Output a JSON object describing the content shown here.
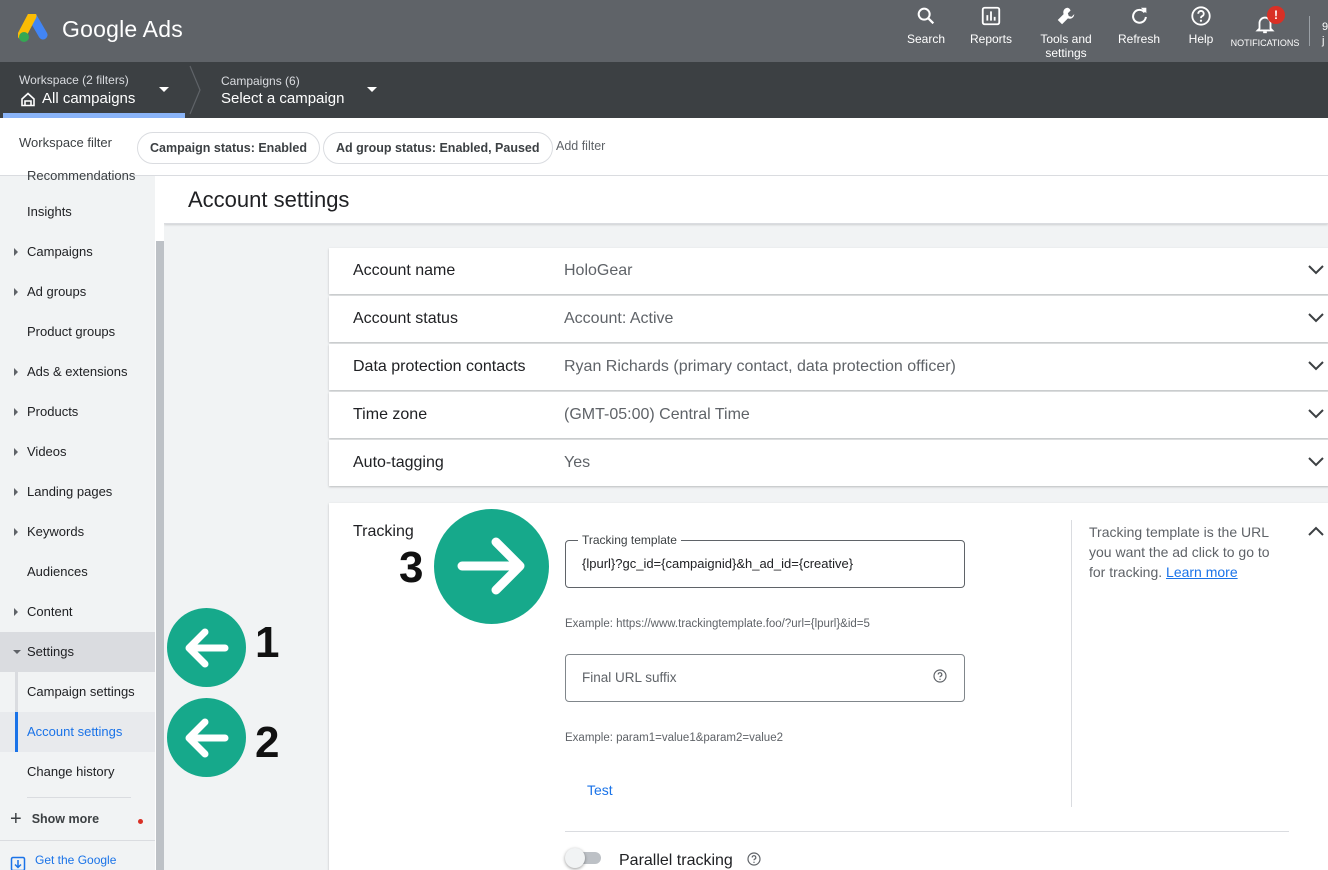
{
  "app": {
    "title": "Google Ads"
  },
  "top_nav": [
    {
      "label": "Search",
      "icon": "search-icon"
    },
    {
      "label": "Reports",
      "icon": "reports-icon"
    },
    {
      "label": "Tools and",
      "label2": "settings",
      "icon": "wrench-icon"
    },
    {
      "label": "Refresh",
      "icon": "refresh-icon"
    },
    {
      "label": "Help",
      "icon": "help-icon"
    },
    {
      "label": "NOTIFICATIONS",
      "icon": "bell-icon",
      "badge": "!"
    }
  ],
  "account_peek": {
    "line1": "9",
    "line2": "j"
  },
  "workspace": {
    "label": "Workspace (2 filters)",
    "value": "All campaigns"
  },
  "campaigns": {
    "label": "Campaigns (6)",
    "value": "Select a campaign"
  },
  "filter_bar": {
    "label": "Workspace filter",
    "chips": [
      "Campaign status: Enabled",
      "Ad group status: Enabled, Paused"
    ],
    "add_filter": "Add filter"
  },
  "sidebar": {
    "cut_item": "Recommendations",
    "items": [
      {
        "label": "Insights",
        "expandable": false
      },
      {
        "label": "Campaigns",
        "expandable": true
      },
      {
        "label": "Ad groups",
        "expandable": true
      },
      {
        "label": "Product groups",
        "expandable": false
      },
      {
        "label": "Ads & extensions",
        "expandable": true
      },
      {
        "label": "Products",
        "expandable": true
      },
      {
        "label": "Videos",
        "expandable": true
      },
      {
        "label": "Landing pages",
        "expandable": true
      },
      {
        "label": "Keywords",
        "expandable": true
      },
      {
        "label": "Audiences",
        "expandable": false
      },
      {
        "label": "Content",
        "expandable": true
      },
      {
        "label": "Settings",
        "expanded": true
      }
    ],
    "sub_items": [
      "Campaign settings",
      "Account settings",
      "Change history"
    ],
    "active_sub_item": "Account settings",
    "show_more": "Show more",
    "get_app": "Get the Google"
  },
  "page": {
    "title": "Account settings"
  },
  "settings_rows": [
    {
      "key": "Account name",
      "value": "HoloGear"
    },
    {
      "key": "Account status",
      "value": "Account: Active"
    },
    {
      "key": "Data protection contacts",
      "value": "Ryan Richards (primary contact, data protection officer)"
    },
    {
      "key": "Time zone",
      "value": "(GMT-05:00) Central Time"
    },
    {
      "key": "Auto-tagging",
      "value": "Yes"
    }
  ],
  "tracking": {
    "title": "Tracking",
    "template_label": "Tracking template",
    "template_value": "{lpurl}?gc_id={campaignid}&h_ad_id={creative}",
    "template_example": "Example: https://www.trackingtemplate.foo/?url={lpurl}&id=5",
    "suffix_placeholder": "Final URL suffix",
    "suffix_example": "Example: param1=value1&param2=value2",
    "test": "Test",
    "help_text": "Tracking template is the URL you want the ad click to go to for tracking.",
    "learn_more": "Learn more",
    "parallel_tracking": "Parallel tracking"
  },
  "annotations": [
    "1",
    "2",
    "3"
  ],
  "colors": {
    "annotation": "#16a98b",
    "accent": "#1a73e8",
    "topbar": "#5f6368",
    "navbar": "#3c4043"
  }
}
